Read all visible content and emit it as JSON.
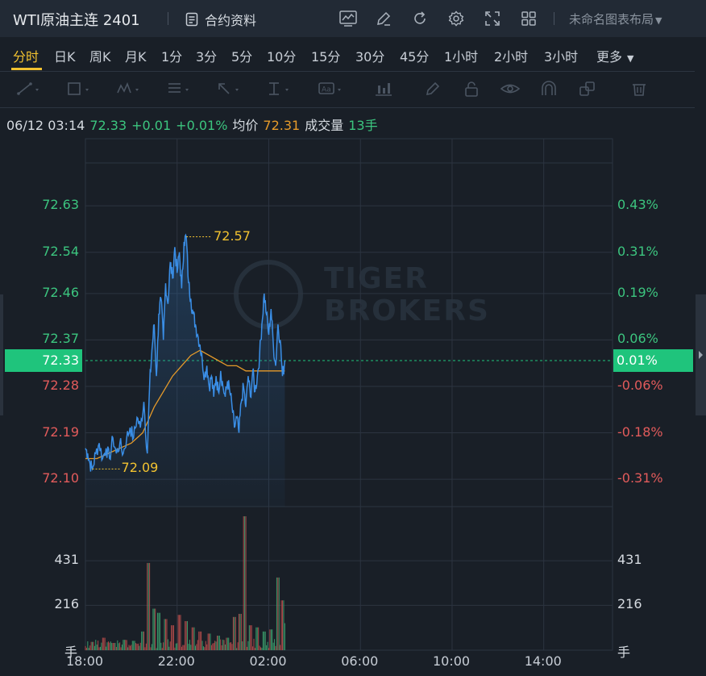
{
  "header": {
    "title": "WTI原油主连 2401",
    "contract_info": "合约资料",
    "layout_name": "未命名图表布局"
  },
  "timeframes": [
    "分时",
    "日K",
    "周K",
    "月K",
    "1分",
    "3分",
    "5分",
    "10分",
    "15分",
    "30分",
    "45分",
    "1小时",
    "2小时",
    "3小时",
    "更多"
  ],
  "active_timeframe": "分时",
  "info": {
    "datetime": "06/12 03:14",
    "price": "72.33",
    "change": "+0.01",
    "change_pct": "+0.01%",
    "avg_label": "均价",
    "avg_value": "72.31",
    "volume_label": "成交量",
    "volume_value": "13手"
  },
  "watermark": [
    "TIGER",
    "BROKERS"
  ],
  "colors": {
    "up": "#3cc57f",
    "down": "#e25b5b",
    "price_line": "#3a8ee6",
    "avg_line": "#e59a2a",
    "marker": "#f2c230",
    "current_tag": "#1fc47c",
    "active_tab": "#f2c230"
  },
  "chart_data": {
    "type": "line",
    "price_ticks": [
      {
        "value": "72.63",
        "pct": "0.43%",
        "color": "up"
      },
      {
        "value": "72.54",
        "pct": "0.31%",
        "color": "up"
      },
      {
        "value": "72.46",
        "pct": "0.19%",
        "color": "up"
      },
      {
        "value": "72.37",
        "pct": "0.06%",
        "color": "up"
      },
      {
        "value": "72.28",
        "pct": "-0.06%",
        "color": "down"
      },
      {
        "value": "72.19",
        "pct": "-0.18%",
        "color": "down"
      },
      {
        "value": "72.10",
        "pct": "-0.31%",
        "color": "down"
      }
    ],
    "y_range": [
      72.047,
      72.76
    ],
    "current_price": "72.33",
    "current_pct": "0.01%",
    "high_label": "72.57",
    "low_label": "72.09",
    "x_ticks": [
      "18:00",
      "22:00",
      "02:00",
      "06:00",
      "10:00",
      "14:00"
    ],
    "x_domain_hours": [
      0,
      23
    ],
    "volume_ticks": [
      "431",
      "216"
    ],
    "volume_unit": "手",
    "volume_max": 645,
    "price_series": [
      [
        0.0,
        72.16
      ],
      [
        0.1,
        72.15
      ],
      [
        0.2,
        72.13
      ],
      [
        0.3,
        72.12
      ],
      [
        0.45,
        72.15
      ],
      [
        0.6,
        72.17
      ],
      [
        0.75,
        72.14
      ],
      [
        0.9,
        72.16
      ],
      [
        1.05,
        72.14
      ],
      [
        1.2,
        72.18
      ],
      [
        1.35,
        72.15
      ],
      [
        1.5,
        72.17
      ],
      [
        1.65,
        72.15
      ],
      [
        1.8,
        72.18
      ],
      [
        1.95,
        72.2
      ],
      [
        2.1,
        72.18
      ],
      [
        2.25,
        72.22
      ],
      [
        2.4,
        72.2
      ],
      [
        2.55,
        72.25
      ],
      [
        2.7,
        72.15
      ],
      [
        2.8,
        72.28
      ],
      [
        2.9,
        72.35
      ],
      [
        3.0,
        72.4
      ],
      [
        3.1,
        72.3
      ],
      [
        3.2,
        72.42
      ],
      [
        3.3,
        72.45
      ],
      [
        3.4,
        72.37
      ],
      [
        3.5,
        72.48
      ],
      [
        3.6,
        72.44
      ],
      [
        3.7,
        72.52
      ],
      [
        3.8,
        72.49
      ],
      [
        3.9,
        72.55
      ],
      [
        4.0,
        72.5
      ],
      [
        4.1,
        72.54
      ],
      [
        4.2,
        72.47
      ],
      [
        4.3,
        72.56
      ],
      [
        4.4,
        72.57
      ],
      [
        4.5,
        72.48
      ],
      [
        4.6,
        72.45
      ],
      [
        4.7,
        72.42
      ],
      [
        4.8,
        72.4
      ],
      [
        4.9,
        72.38
      ],
      [
        5.0,
        72.36
      ],
      [
        5.1,
        72.33
      ],
      [
        5.2,
        72.3
      ],
      [
        5.3,
        72.32
      ],
      [
        5.4,
        72.28
      ],
      [
        5.5,
        72.3
      ],
      [
        5.6,
        72.26
      ],
      [
        5.7,
        72.3
      ],
      [
        5.8,
        72.27
      ],
      [
        5.9,
        72.31
      ],
      [
        6.0,
        72.28
      ],
      [
        6.1,
        72.26
      ],
      [
        6.2,
        72.29
      ],
      [
        6.3,
        72.27
      ],
      [
        6.4,
        72.24
      ],
      [
        6.5,
        72.2
      ],
      [
        6.6,
        72.22
      ],
      [
        6.7,
        72.19
      ],
      [
        6.8,
        72.25
      ],
      [
        6.9,
        72.28
      ],
      [
        7.0,
        72.24
      ],
      [
        7.1,
        72.3
      ],
      [
        7.2,
        72.26
      ],
      [
        7.3,
        72.31
      ],
      [
        7.4,
        72.27
      ],
      [
        7.5,
        72.3
      ],
      [
        7.6,
        72.34
      ],
      [
        7.7,
        72.4
      ],
      [
        7.8,
        72.46
      ],
      [
        7.9,
        72.42
      ],
      [
        8.0,
        72.38
      ],
      [
        8.1,
        72.43
      ],
      [
        8.2,
        72.36
      ],
      [
        8.3,
        72.32
      ],
      [
        8.4,
        72.4
      ],
      [
        8.5,
        72.37
      ],
      [
        8.6,
        72.3
      ],
      [
        8.7,
        72.33
      ]
    ],
    "avg_series": [
      [
        0.0,
        72.14
      ],
      [
        0.5,
        72.14
      ],
      [
        1.0,
        72.15
      ],
      [
        1.5,
        72.16
      ],
      [
        2.0,
        72.17
      ],
      [
        2.5,
        72.19
      ],
      [
        2.8,
        72.22
      ],
      [
        3.0,
        72.24
      ],
      [
        3.4,
        72.27
      ],
      [
        3.8,
        72.3
      ],
      [
        4.2,
        72.32
      ],
      [
        4.6,
        72.34
      ],
      [
        5.0,
        72.35
      ],
      [
        5.4,
        72.34
      ],
      [
        5.8,
        72.33
      ],
      [
        6.2,
        72.32
      ],
      [
        6.6,
        72.32
      ],
      [
        7.0,
        72.31
      ],
      [
        7.4,
        72.31
      ],
      [
        7.8,
        72.31
      ],
      [
        8.2,
        72.31
      ],
      [
        8.7,
        72.31
      ]
    ],
    "volume_peaks": [
      [
        0.3,
        40
      ],
      [
        0.8,
        60
      ],
      [
        1.2,
        35
      ],
      [
        1.7,
        50
      ],
      [
        2.1,
        45
      ],
      [
        2.5,
        90
      ],
      [
        2.75,
        420
      ],
      [
        3.0,
        200
      ],
      [
        3.2,
        180
      ],
      [
        3.5,
        150
      ],
      [
        3.8,
        120
      ],
      [
        4.1,
        170
      ],
      [
        4.4,
        140
      ],
      [
        4.7,
        110
      ],
      [
        5.0,
        90
      ],
      [
        5.4,
        80
      ],
      [
        5.8,
        70
      ],
      [
        6.2,
        60
      ],
      [
        6.5,
        160
      ],
      [
        6.75,
        175
      ],
      [
        6.95,
        645
      ],
      [
        7.2,
        120
      ],
      [
        7.5,
        110
      ],
      [
        7.8,
        90
      ],
      [
        8.1,
        100
      ],
      [
        8.4,
        350
      ],
      [
        8.6,
        240
      ],
      [
        8.7,
        130
      ]
    ]
  }
}
